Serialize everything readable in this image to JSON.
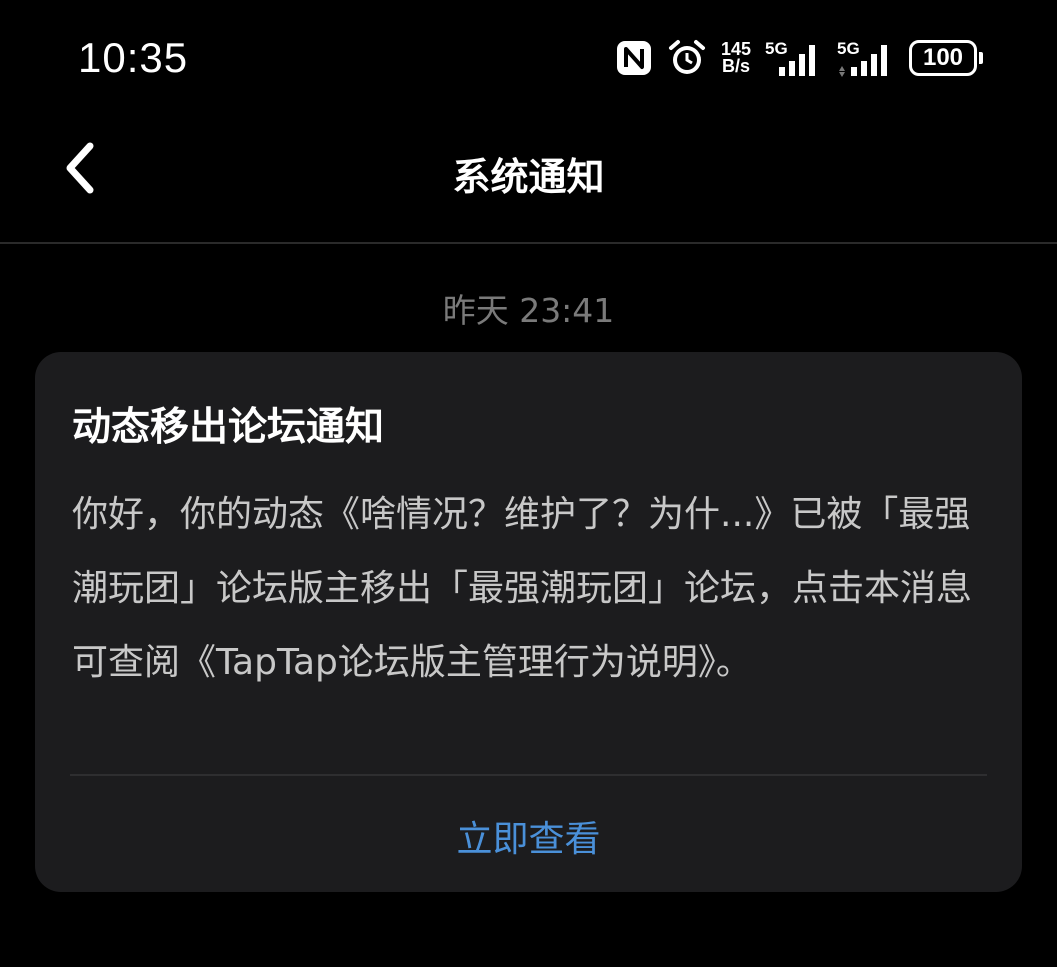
{
  "status_bar": {
    "time": "10:35",
    "net_speed_value": "145",
    "net_speed_unit": "B/s",
    "signal_1_label": "5G",
    "signal_2_label": "5G",
    "battery": "100"
  },
  "nav": {
    "title": "系统通知"
  },
  "messages": [
    {
      "timestamp": "昨天  23:41",
      "title": "动态移出论坛通知",
      "body": "你好，你的动态《啥情况？维护了？为什...》已被「最强潮玩团」论坛版主移出「最强潮玩团」论坛，点击本消息可查阅《TapTap论坛版主管理行为说明》。",
      "action_label": "立即查看"
    }
  ],
  "colors": {
    "background": "#000000",
    "card": "#1c1c1e",
    "accent": "#4a90d9",
    "muted": "#7a7a7a"
  }
}
